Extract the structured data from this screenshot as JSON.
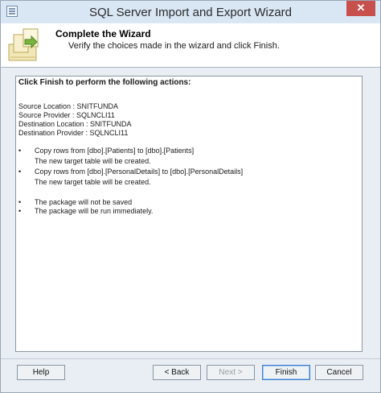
{
  "window": {
    "title": "SQL Server Import and Export Wizard",
    "close_glyph": "✕"
  },
  "header": {
    "title": "Complete the Wizard",
    "subtitle": "Verify the choices made in the wizard and click Finish."
  },
  "summary": {
    "heading": "Click Finish to perform the following actions:",
    "details": [
      "Source Location : SNITFUNDA",
      "Source Provider : SQLNCLI11",
      "Destination Location : SNITFUNDA",
      "Destination Provider : SQLNCLI11"
    ],
    "actions": [
      {
        "text": "Copy rows from [dbo].[Patients] to [dbo].[Patients]",
        "note": "The new target table will be created."
      },
      {
        "text": "Copy rows from [dbo].[PersonalDetails] to [dbo].[PersonalDetails]",
        "note": "The new target table will be created."
      }
    ],
    "package": [
      "The package will not be saved",
      "The package will be run immediately."
    ],
    "bullet": "•"
  },
  "buttons": {
    "help": "Help",
    "back": "< Back",
    "next": "Next >",
    "finish": "Finish",
    "cancel": "Cancel"
  },
  "colors": {
    "close_button": "#c7504d",
    "titlebar": "#d9e6f4",
    "default_button_border": "#3d7dcc"
  }
}
